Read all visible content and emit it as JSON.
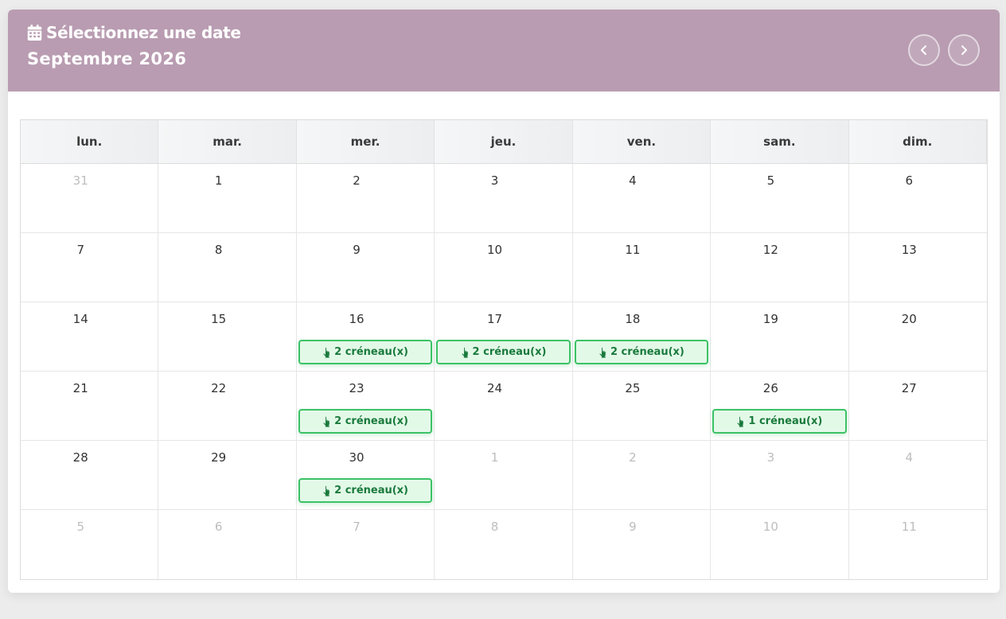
{
  "header": {
    "title": "Sélectionnez une date",
    "month": "Septembre 2026",
    "calendar_icon": "calendar-icon",
    "prev_icon": "chevron-left-icon",
    "next_icon": "chevron-right-icon",
    "accent_color": "#b99cb1"
  },
  "weekdays": [
    "lun.",
    "mar.",
    "mer.",
    "jeu.",
    "ven.",
    "sam.",
    "dim."
  ],
  "weeks": [
    [
      {
        "day": "31",
        "other": true
      },
      {
        "day": "1"
      },
      {
        "day": "2"
      },
      {
        "day": "3"
      },
      {
        "day": "4"
      },
      {
        "day": "5"
      },
      {
        "day": "6"
      }
    ],
    [
      {
        "day": "7"
      },
      {
        "day": "8"
      },
      {
        "day": "9"
      },
      {
        "day": "10"
      },
      {
        "day": "11"
      },
      {
        "day": "12"
      },
      {
        "day": "13"
      }
    ],
    [
      {
        "day": "14"
      },
      {
        "day": "15"
      },
      {
        "day": "16",
        "slot": "2 créneau(x)"
      },
      {
        "day": "17",
        "slot": "2 créneau(x)"
      },
      {
        "day": "18",
        "slot": "2 créneau(x)"
      },
      {
        "day": "19"
      },
      {
        "day": "20"
      }
    ],
    [
      {
        "day": "21"
      },
      {
        "day": "22"
      },
      {
        "day": "23",
        "slot": "2 créneau(x)"
      },
      {
        "day": "24"
      },
      {
        "day": "25"
      },
      {
        "day": "26",
        "slot": "1 créneau(x)"
      },
      {
        "day": "27"
      }
    ],
    [
      {
        "day": "28"
      },
      {
        "day": "29"
      },
      {
        "day": "30",
        "slot": "2 créneau(x)"
      },
      {
        "day": "1",
        "other": true
      },
      {
        "day": "2",
        "other": true
      },
      {
        "day": "3",
        "other": true
      },
      {
        "day": "4",
        "other": true
      }
    ],
    [
      {
        "day": "5",
        "other": true
      },
      {
        "day": "6",
        "other": true
      },
      {
        "day": "7",
        "other": true
      },
      {
        "day": "8",
        "other": true
      },
      {
        "day": "9",
        "other": true
      },
      {
        "day": "10",
        "other": true
      },
      {
        "day": "11",
        "other": true
      }
    ]
  ],
  "slot_icon": "pointer-hand-icon",
  "slot_color": "#3cc266"
}
